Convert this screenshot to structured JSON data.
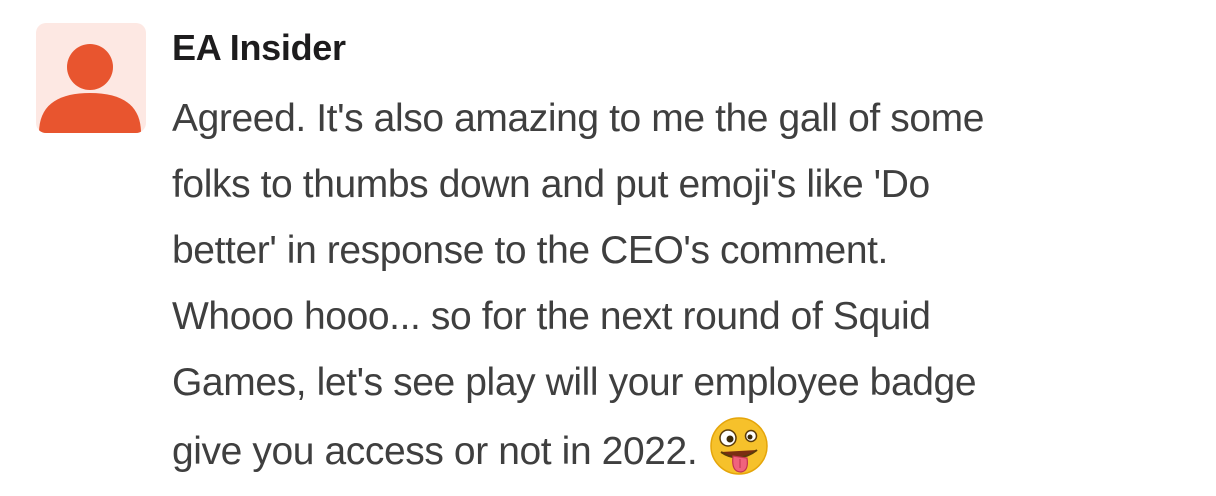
{
  "message": {
    "author": "EA Insider",
    "lines": [
      "Agreed. It's also amazing to me the gall of some",
      "folks to thumbs down and put emoji's like 'Do",
      "better' in response to the CEO's comment.",
      "Whooo hooo... so for the next round of Squid",
      "Games, let's see play will your employee badge",
      "give you access or not in 2022."
    ],
    "emoji": "zany-face-icon"
  },
  "colors": {
    "avatar_bg": "#fde8e3",
    "avatar_fg": "#e8552f",
    "author_text": "#1d1c1d",
    "body_text": "#3f3f3f"
  }
}
